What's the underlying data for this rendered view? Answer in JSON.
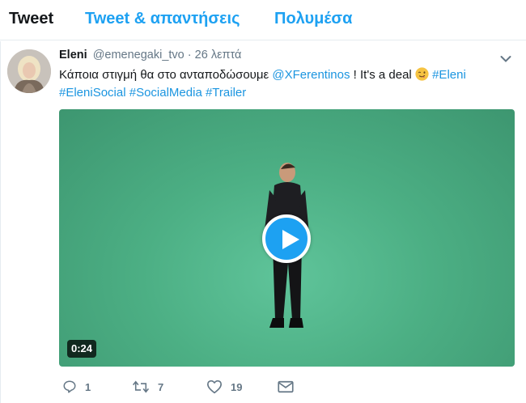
{
  "tabs": [
    {
      "label": "Tweet"
    },
    {
      "label": "Tweet & απαντήσεις"
    },
    {
      "label": "Πολυμέσα"
    }
  ],
  "tweet": {
    "name": "Eleni",
    "handle": "@emenegaki_tvo",
    "separator": "·",
    "time": "26 λεπτά",
    "text_prefix": "Κάποια στιγμή θα στο ανταποδώσουμε",
    "mention": "@XFerentinos",
    "text_middle": " ! It's a deal",
    "hashtags": [
      "#Eleni",
      "#EleniSocial",
      "#SocialMedia",
      "#Trailer"
    ],
    "emoji": "winking-face-with-tongue-icon",
    "video_duration": "0:24",
    "counts": {
      "replies": "1",
      "retweets": "7",
      "likes": "19"
    }
  },
  "colors": {
    "accent": "#1da1f2",
    "link": "#1b95e0",
    "muted": "#657786",
    "video_bg": "#4caf84"
  }
}
